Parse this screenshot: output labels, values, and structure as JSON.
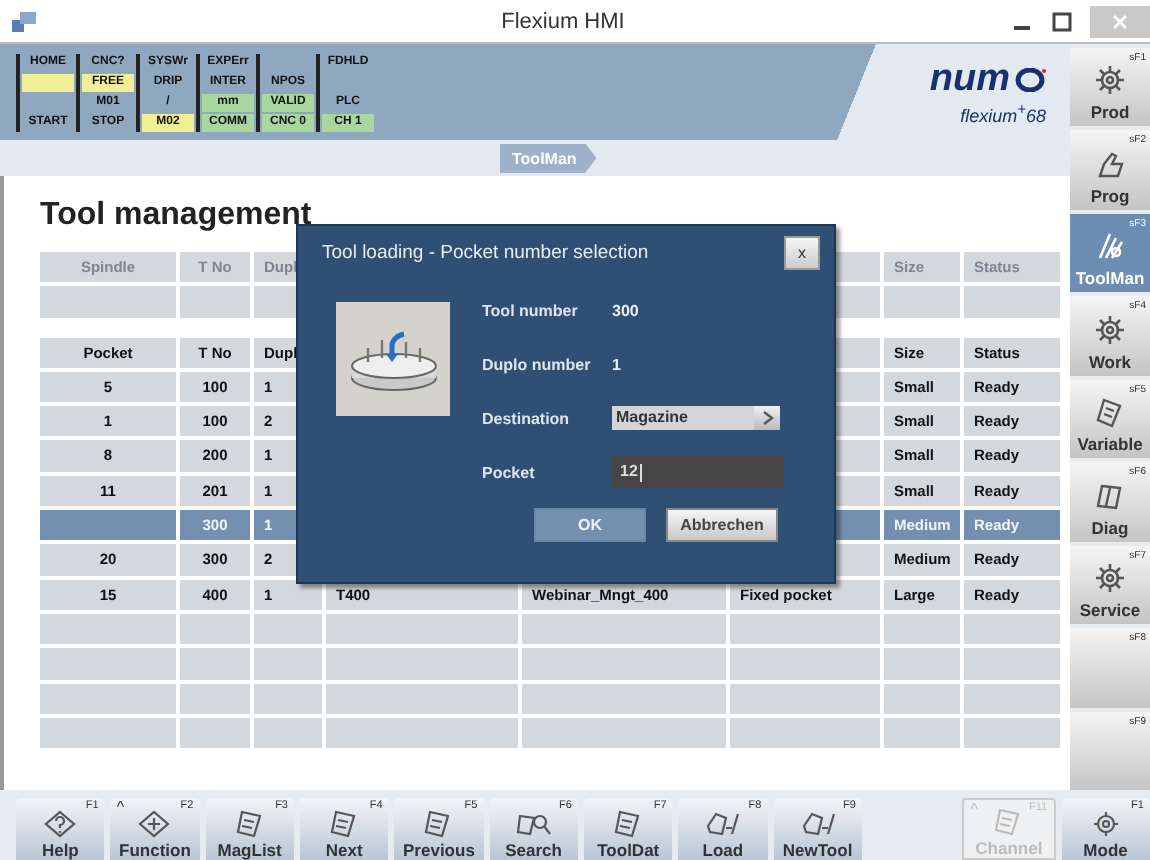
{
  "window": {
    "title": "Flexium HMI"
  },
  "status_panel": {
    "columns": [
      [
        {
          "text": "HOME",
          "color": "#8fa8bf"
        },
        {
          "color": "#f2ee96"
        },
        {
          "color": "#8fa8bf"
        },
        {
          "text": "START",
          "color": "#8fa8bf"
        }
      ],
      [
        {
          "text": "CNC?",
          "color": "#8fa8bf"
        },
        {
          "text": "FREE",
          "color": "#f2ee96"
        },
        {
          "text": "M01",
          "color": "#8fa8bf"
        },
        {
          "text": "STOP",
          "color": "#8fa8bf"
        }
      ],
      [
        {
          "text": "SYSWr",
          "color": "#8fa8bf"
        },
        {
          "text": "DRIP",
          "color": "#8fa8bf"
        },
        {
          "text": "/",
          "color": "#8fa8bf"
        },
        {
          "text": "M02",
          "color": "#f2ee96"
        }
      ],
      [
        {
          "text": "EXPErr",
          "color": "#8fa8bf"
        },
        {
          "text": "INTER",
          "color": "#8fa8bf"
        },
        {
          "text": "mm",
          "color": "#a8d8a0"
        },
        {
          "text": "COMM",
          "color": "#a8d8a0"
        }
      ],
      [
        {
          "color": "#8fa8bf"
        },
        {
          "text": "NPOS",
          "color": "#8fa8bf"
        },
        {
          "text": "VALID",
          "color": "#a8d8a0"
        },
        {
          "text": "CNC 0",
          "color": "#a8d8a0"
        }
      ],
      [
        {
          "text": "FDHLD",
          "color": "#8fa8bf"
        },
        {
          "color": "#8fa8bf"
        },
        {
          "text": "PLC",
          "color": "#8fa8bf"
        },
        {
          "text": "CH 1",
          "color": "#a8d8a0"
        }
      ]
    ]
  },
  "logo": {
    "brand": "num",
    "product": "flexium$^{+}$68"
  },
  "breadcrumb": {
    "label": "ToolMan"
  },
  "page_title": "Tool management",
  "spindle_table": {
    "header": {
      "spindle": "Spindle",
      "t_no": "T No",
      "duplo": "Dupl",
      "size": "Size",
      "status": "Status"
    }
  },
  "pocket_table": {
    "header": {
      "pocket": "Pocket",
      "t_no": "T No",
      "duplo": "Dupl",
      "size": "Size",
      "status": "Status"
    },
    "rows": [
      {
        "pocket": "5",
        "t_no": "100",
        "duplo": "1",
        "size": "Small",
        "status": "Ready",
        "selected": false
      },
      {
        "pocket": "1",
        "t_no": "100",
        "duplo": "2",
        "size": "Small",
        "status": "Ready",
        "selected": false
      },
      {
        "pocket": "8",
        "t_no": "200",
        "duplo": "1",
        "size": "Small",
        "status": "Ready",
        "selected": false
      },
      {
        "pocket": "11",
        "t_no": "201",
        "duplo": "1",
        "size": "Small",
        "status": "Ready",
        "selected": false
      },
      {
        "t_no": "300",
        "duplo": "1",
        "size": "Medium",
        "status": "Ready",
        "selected": true
      },
      {
        "pocket": "20",
        "t_no": "300",
        "duplo": "2",
        "size": "Medium",
        "status": "Ready",
        "selected": false
      },
      {
        "pocket": "15",
        "t_no": "400",
        "duplo": "1",
        "column_4": "T400",
        "column_5": "Webinar_Mngt_400",
        "column_6": "Fixed pocket",
        "size": "Large",
        "status": "Ready",
        "selected": false
      }
    ]
  },
  "dialog": {
    "title": "Tool loading - Pocket number selection",
    "close": "x",
    "fields": [
      {
        "kind": "value",
        "label": "Tool number",
        "value": "300"
      },
      {
        "kind": "value",
        "label": "Duplo number",
        "value": "1"
      },
      {
        "kind": "select",
        "label": "Destination",
        "value": "Magazine"
      },
      {
        "kind": "input",
        "label": "Pocket",
        "value": "12"
      }
    ],
    "buttons": [
      {
        "label": "OK",
        "disabled": true
      },
      {
        "label": "Abbrechen",
        "disabled": false
      }
    ]
  },
  "softkeys": [
    {
      "key": "sF1",
      "label": "Prod",
      "selected": false
    },
    {
      "key": "sF2",
      "label": "Prog",
      "selected": false
    },
    {
      "key": "sF3",
      "label": "ToolMan",
      "selected": true
    },
    {
      "key": "sF4",
      "label": "Work",
      "selected": false
    },
    {
      "key": "sF5",
      "label": "Variable",
      "selected": false
    },
    {
      "key": "sF6",
      "label": "Diag",
      "selected": false
    },
    {
      "key": "sF7",
      "label": "Service",
      "selected": false
    },
    {
      "key": "sF8",
      "selected": false
    },
    {
      "key": "sF9",
      "selected": false
    }
  ],
  "function_keys": [
    {
      "kind": "key",
      "key": "F1",
      "label": "Help",
      "disabled": false
    },
    {
      "kind": "key",
      "key": "F2",
      "caret": "^",
      "label": "Function",
      "disabled": false
    },
    {
      "kind": "key",
      "key": "F3",
      "label": "MagList",
      "disabled": false
    },
    {
      "kind": "key",
      "key": "F4",
      "label": "Next",
      "disabled": false
    },
    {
      "kind": "key",
      "key": "F5",
      "label": "Previous",
      "disabled": false
    },
    {
      "kind": "key",
      "key": "F6",
      "label": "Search",
      "disabled": false
    },
    {
      "kind": "key",
      "key": "F7",
      "label": "ToolDat",
      "disabled": false
    },
    {
      "kind": "key",
      "key": "F8",
      "label": "Load",
      "disabled": false
    },
    {
      "kind": "key",
      "key": "F9",
      "label": "NewTool",
      "disabled": false
    },
    {
      "kind": "empty"
    },
    {
      "kind": "key",
      "key": "F11",
      "caret": "^",
      "label": "Channel",
      "disabled": true
    },
    {
      "kind": "key",
      "key": "F1",
      "label": "Mode",
      "disabled": false
    }
  ]
}
